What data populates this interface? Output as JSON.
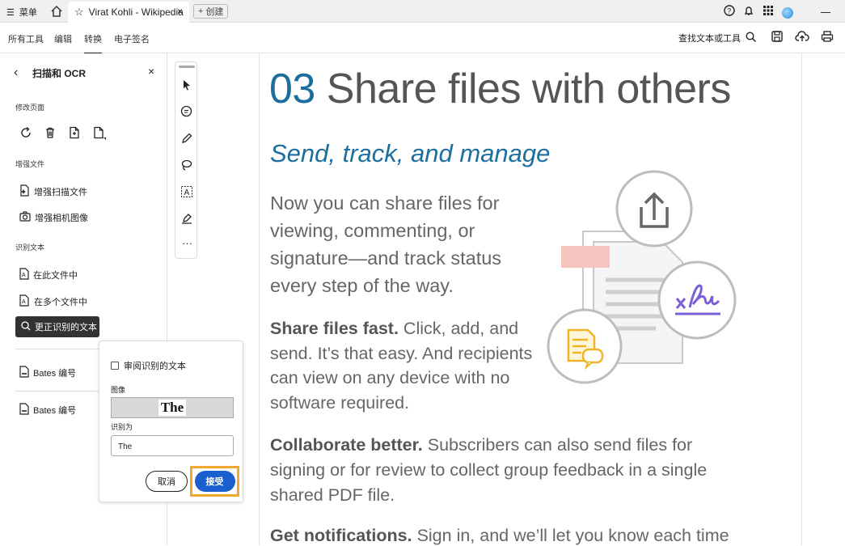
{
  "tabbar": {
    "menu_label": "菜单",
    "tab_title": "Virat Kohli - Wikipedia",
    "new_tab_label": "创建"
  },
  "toolbar": {
    "items": [
      "所有工具",
      "编辑",
      "转换",
      "电子签名"
    ],
    "find_label": "查找文本或工具"
  },
  "panel": {
    "title": "扫描和 OCR",
    "sections": {
      "modify": "修改页面",
      "enhance": "增强文件",
      "recognize": "识别文本"
    },
    "enhance_items": [
      "增强扫描文件",
      "增强相机图像"
    ],
    "recognize_items": [
      "在此文件中",
      "在多个文件中"
    ],
    "fix_label": "更正识别的文本",
    "bates": [
      "Bates 编号",
      "Bates 编号"
    ]
  },
  "popup": {
    "checkbox_label": "审阅识别的文本",
    "image_label": "图像",
    "image_word": "The",
    "recognized_label": "识别为",
    "recognized_value": "The",
    "cancel": "取消",
    "accept": "接受"
  },
  "document": {
    "number": "03",
    "heading": "Share files with others",
    "subheading": "Send, track, and manage",
    "intro": [
      "Now you can share files for",
      "viewing, commenting, or",
      "signature—and track status",
      "every step of the way."
    ],
    "p1_bold": "Share files fast.",
    "p1_lines": [
      " Click, add, and",
      "send. It’s that easy. And recipients",
      "can view on any device with no",
      "software required."
    ],
    "p2_bold": "Collaborate better.",
    "p2_lines": [
      " Subscribers can also send files for",
      "signing or for review to collect group feedback in a single",
      "shared PDF file."
    ],
    "p3_bold": "Get notifications.",
    "p3_line": " Sign in, and we’ll let you know each time",
    "colors": {
      "accent": "#1b6e9e",
      "signature": "#7b5fd6",
      "sticky": "#f0b429",
      "pink": "#f6c3c0",
      "accept_button": "#1a5fd0",
      "highlight": "#f0a830"
    }
  }
}
